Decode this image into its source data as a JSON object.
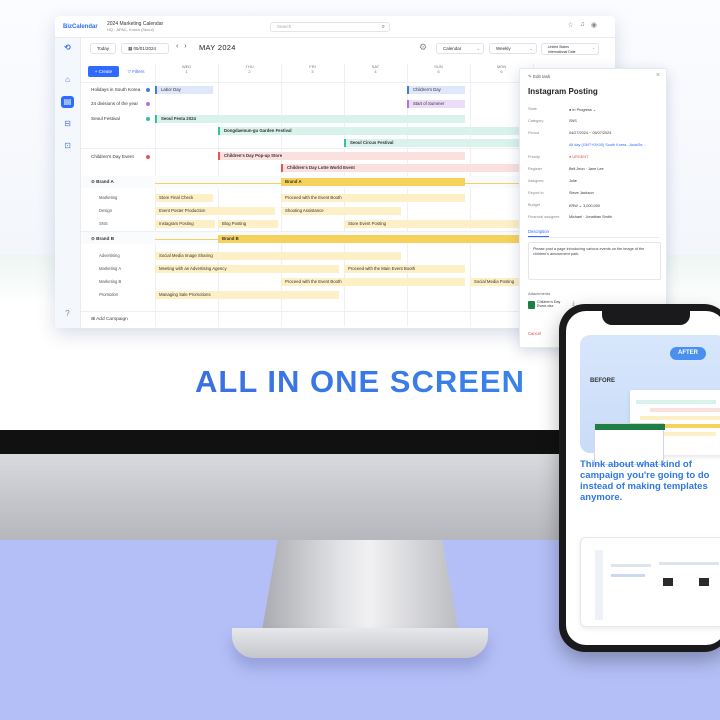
{
  "headline": "ALL IN ONE SCREEN",
  "app": {
    "logo": "BizCalendar",
    "calendar_title": "2024 Marketing Calendar",
    "calendar_subtitle": "HQ · APAC, Korea (Seoul)",
    "search_placeholder": "Search",
    "today_label": "Today",
    "date_value": "05/01/2024",
    "month_label": "MAY 2024",
    "view_select": "Calendar",
    "period_select": "Weekly",
    "region_line1": "United States",
    "region_line2": "International Date",
    "create_label": "+ Create",
    "filters_label": "Filters",
    "add_campaign": "Add Campaign",
    "days": [
      {
        "name": "WED",
        "num": "1"
      },
      {
        "name": "THU",
        "num": "2"
      },
      {
        "name": "FRI",
        "num": "3"
      },
      {
        "name": "SAT",
        "num": "4"
      },
      {
        "name": "SUN",
        "num": "5"
      },
      {
        "name": "MON",
        "num": "6"
      }
    ],
    "rows": {
      "holidays": "Holidays in South Korea",
      "divisions": "24 divisions of the year",
      "seoul": "Seoul Festival",
      "childrens": "Children's Day Event",
      "brand_a": "Brand A",
      "marketing": "Marketing",
      "design": "Design",
      "sns": "SNS",
      "brand_b": "Brand B",
      "advertising": "Advertising",
      "marketing_a": "Marketing A",
      "marketing_b": "Marketing B",
      "promotion": "Promotion"
    },
    "events": {
      "labor_day": "Labor Day",
      "childrens_day": "Children's Day",
      "start_summer": "Start of Summer",
      "seoul_festa": "Seoul Festa 2024",
      "dongdaemun": "Dongdaemun-gu Garden Festival",
      "circus": "Seoul Circus Festival",
      "popup": "Children's Day Pop-up Store",
      "lotte": "Children's Day Lotte World Event",
      "brand_a_bar": "Brand A",
      "final_check": "Store Final Check",
      "event_booth_1": "Proceed with the Event Booth",
      "poster": "Event Poster Production",
      "shooting": "Shooting Assistance",
      "insta": "Instagram Posting",
      "blog": "Blog Posting",
      "store_posting": "Store Event Posting",
      "brand_b_bar": "Brand B",
      "social_image": "Social Media Image Sharing",
      "meeting": "Meeting with an Advertising Agency",
      "main_booth": "Proceed with the Main Event Booth",
      "event_booth_2": "Proceed with the Event Booth",
      "social_posting": "Social Media Posting",
      "sale_promo": "Managing Sale Promotions"
    }
  },
  "panel": {
    "header": "Edit task",
    "title": "Instagram Posting",
    "fields": [
      {
        "key": "State",
        "value": "● In Progress ⌄"
      },
      {
        "key": "Category",
        "value": "SNS"
      },
      {
        "key": "Period",
        "value": "04/27/2024 ~ 05/07/2024"
      },
      {
        "key": "",
        "value": "All day   (GMT+09:00) South Korea - Asia/Se..."
      },
      {
        "key": "Priority",
        "value": "● URGENT"
      },
      {
        "key": "Register",
        "value": "Bell Jeon · Jane Lee"
      },
      {
        "key": "Assignee",
        "value": "Julie"
      },
      {
        "key": "Report to",
        "value": "Steve Jackson"
      },
      {
        "key": "Budget",
        "value": "KRW  ⌄  3,000,000"
      },
      {
        "key": "Financial assignee",
        "value": "Michael · Jonathan Smith"
      }
    ],
    "tab_description": "Description",
    "description": "Please post a page introducing various events on the image of the children's amusement park.",
    "attachments_label": "Attachments",
    "attachment_name": "Children's Day Event.xlsx",
    "cancel_label": "Cancel"
  },
  "phone": {
    "after_badge": "AFTER",
    "before_label": "BEFORE",
    "tagline": "Think about what kind of campaign you're going to do instead of making templates anymore."
  },
  "colors": {
    "brand_blue": "#2f6bff",
    "blue_event": "#dfe8fb",
    "purple_event": "#ecdcf8",
    "mint_event": "#d9f3ec",
    "red_event": "#fbe0e0",
    "yellow_event": "#fdf0c6",
    "brand_bar": "#f6d25c",
    "phone_text": "#2f78e6",
    "backdrop_blue": "#b4bff7"
  }
}
